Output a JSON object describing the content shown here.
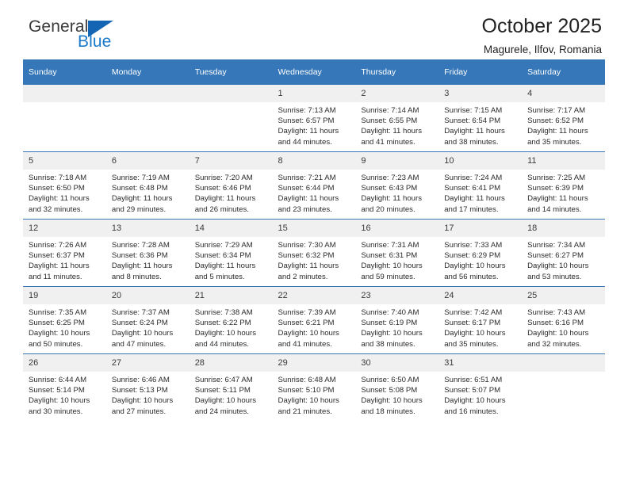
{
  "brand": {
    "word1": "General",
    "word2": "Blue",
    "triangle_color": "#1565b5",
    "blue_color": "#1b79c9"
  },
  "header": {
    "title": "October 2025",
    "location": "Magurele, Ilfov, Romania"
  },
  "calendar": {
    "accent_color": "#3577b9",
    "daynum_bg": "#f0f0f0",
    "weekdays": [
      "Sunday",
      "Monday",
      "Tuesday",
      "Wednesday",
      "Thursday",
      "Friday",
      "Saturday"
    ],
    "labels": {
      "sunrise": "Sunrise:",
      "sunset": "Sunset:",
      "daylight": "Daylight:"
    },
    "weeks": [
      [
        {
          "day": ""
        },
        {
          "day": ""
        },
        {
          "day": ""
        },
        {
          "day": "1",
          "sunrise": "Sunrise: 7:13 AM",
          "sunset": "Sunset: 6:57 PM",
          "daylight": "Daylight: 11 hours and 44 minutes."
        },
        {
          "day": "2",
          "sunrise": "Sunrise: 7:14 AM",
          "sunset": "Sunset: 6:55 PM",
          "daylight": "Daylight: 11 hours and 41 minutes."
        },
        {
          "day": "3",
          "sunrise": "Sunrise: 7:15 AM",
          "sunset": "Sunset: 6:54 PM",
          "daylight": "Daylight: 11 hours and 38 minutes."
        },
        {
          "day": "4",
          "sunrise": "Sunrise: 7:17 AM",
          "sunset": "Sunset: 6:52 PM",
          "daylight": "Daylight: 11 hours and 35 minutes."
        }
      ],
      [
        {
          "day": "5",
          "sunrise": "Sunrise: 7:18 AM",
          "sunset": "Sunset: 6:50 PM",
          "daylight": "Daylight: 11 hours and 32 minutes."
        },
        {
          "day": "6",
          "sunrise": "Sunrise: 7:19 AM",
          "sunset": "Sunset: 6:48 PM",
          "daylight": "Daylight: 11 hours and 29 minutes."
        },
        {
          "day": "7",
          "sunrise": "Sunrise: 7:20 AM",
          "sunset": "Sunset: 6:46 PM",
          "daylight": "Daylight: 11 hours and 26 minutes."
        },
        {
          "day": "8",
          "sunrise": "Sunrise: 7:21 AM",
          "sunset": "Sunset: 6:44 PM",
          "daylight": "Daylight: 11 hours and 23 minutes."
        },
        {
          "day": "9",
          "sunrise": "Sunrise: 7:23 AM",
          "sunset": "Sunset: 6:43 PM",
          "daylight": "Daylight: 11 hours and 20 minutes."
        },
        {
          "day": "10",
          "sunrise": "Sunrise: 7:24 AM",
          "sunset": "Sunset: 6:41 PM",
          "daylight": "Daylight: 11 hours and 17 minutes."
        },
        {
          "day": "11",
          "sunrise": "Sunrise: 7:25 AM",
          "sunset": "Sunset: 6:39 PM",
          "daylight": "Daylight: 11 hours and 14 minutes."
        }
      ],
      [
        {
          "day": "12",
          "sunrise": "Sunrise: 7:26 AM",
          "sunset": "Sunset: 6:37 PM",
          "daylight": "Daylight: 11 hours and 11 minutes."
        },
        {
          "day": "13",
          "sunrise": "Sunrise: 7:28 AM",
          "sunset": "Sunset: 6:36 PM",
          "daylight": "Daylight: 11 hours and 8 minutes."
        },
        {
          "day": "14",
          "sunrise": "Sunrise: 7:29 AM",
          "sunset": "Sunset: 6:34 PM",
          "daylight": "Daylight: 11 hours and 5 minutes."
        },
        {
          "day": "15",
          "sunrise": "Sunrise: 7:30 AM",
          "sunset": "Sunset: 6:32 PM",
          "daylight": "Daylight: 11 hours and 2 minutes."
        },
        {
          "day": "16",
          "sunrise": "Sunrise: 7:31 AM",
          "sunset": "Sunset: 6:31 PM",
          "daylight": "Daylight: 10 hours and 59 minutes."
        },
        {
          "day": "17",
          "sunrise": "Sunrise: 7:33 AM",
          "sunset": "Sunset: 6:29 PM",
          "daylight": "Daylight: 10 hours and 56 minutes."
        },
        {
          "day": "18",
          "sunrise": "Sunrise: 7:34 AM",
          "sunset": "Sunset: 6:27 PM",
          "daylight": "Daylight: 10 hours and 53 minutes."
        }
      ],
      [
        {
          "day": "19",
          "sunrise": "Sunrise: 7:35 AM",
          "sunset": "Sunset: 6:25 PM",
          "daylight": "Daylight: 10 hours and 50 minutes."
        },
        {
          "day": "20",
          "sunrise": "Sunrise: 7:37 AM",
          "sunset": "Sunset: 6:24 PM",
          "daylight": "Daylight: 10 hours and 47 minutes."
        },
        {
          "day": "21",
          "sunrise": "Sunrise: 7:38 AM",
          "sunset": "Sunset: 6:22 PM",
          "daylight": "Daylight: 10 hours and 44 minutes."
        },
        {
          "day": "22",
          "sunrise": "Sunrise: 7:39 AM",
          "sunset": "Sunset: 6:21 PM",
          "daylight": "Daylight: 10 hours and 41 minutes."
        },
        {
          "day": "23",
          "sunrise": "Sunrise: 7:40 AM",
          "sunset": "Sunset: 6:19 PM",
          "daylight": "Daylight: 10 hours and 38 minutes."
        },
        {
          "day": "24",
          "sunrise": "Sunrise: 7:42 AM",
          "sunset": "Sunset: 6:17 PM",
          "daylight": "Daylight: 10 hours and 35 minutes."
        },
        {
          "day": "25",
          "sunrise": "Sunrise: 7:43 AM",
          "sunset": "Sunset: 6:16 PM",
          "daylight": "Daylight: 10 hours and 32 minutes."
        }
      ],
      [
        {
          "day": "26",
          "sunrise": "Sunrise: 6:44 AM",
          "sunset": "Sunset: 5:14 PM",
          "daylight": "Daylight: 10 hours and 30 minutes."
        },
        {
          "day": "27",
          "sunrise": "Sunrise: 6:46 AM",
          "sunset": "Sunset: 5:13 PM",
          "daylight": "Daylight: 10 hours and 27 minutes."
        },
        {
          "day": "28",
          "sunrise": "Sunrise: 6:47 AM",
          "sunset": "Sunset: 5:11 PM",
          "daylight": "Daylight: 10 hours and 24 minutes."
        },
        {
          "day": "29",
          "sunrise": "Sunrise: 6:48 AM",
          "sunset": "Sunset: 5:10 PM",
          "daylight": "Daylight: 10 hours and 21 minutes."
        },
        {
          "day": "30",
          "sunrise": "Sunrise: 6:50 AM",
          "sunset": "Sunset: 5:08 PM",
          "daylight": "Daylight: 10 hours and 18 minutes."
        },
        {
          "day": "31",
          "sunrise": "Sunrise: 6:51 AM",
          "sunset": "Sunset: 5:07 PM",
          "daylight": "Daylight: 10 hours and 16 minutes."
        },
        {
          "day": ""
        }
      ]
    ]
  }
}
